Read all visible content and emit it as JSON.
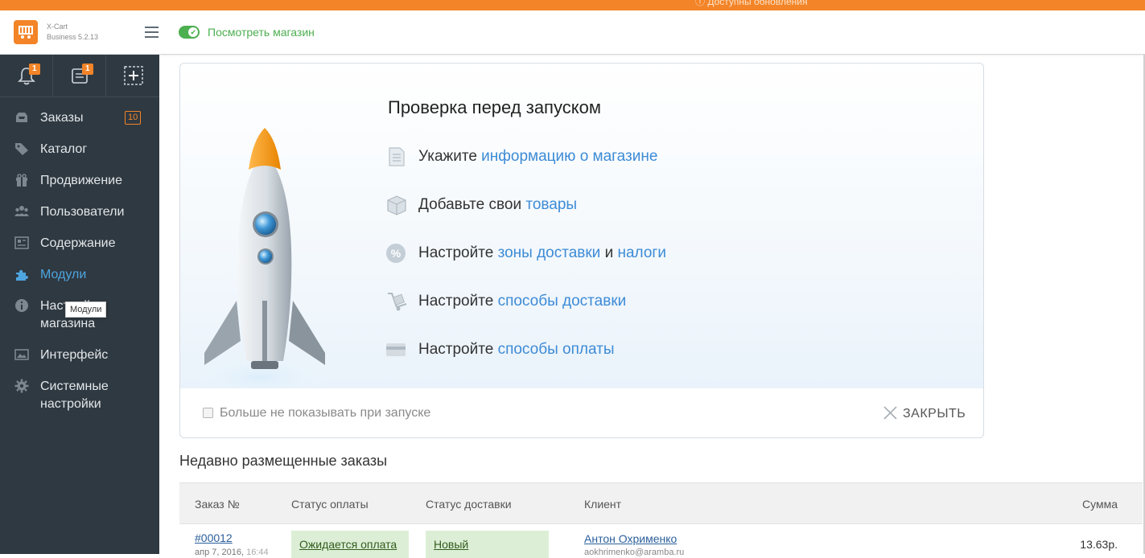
{
  "top_strip": {
    "updates_text": "Доступны обновления"
  },
  "header": {
    "brand_line1": "X-Cart",
    "brand_line2": "Business 5.2.13",
    "view_store_label": "Посмотреть магазин"
  },
  "quick_actions": [
    {
      "icon": "bell-icon",
      "badge": "1"
    },
    {
      "icon": "inbox-icon",
      "badge": "1"
    },
    {
      "icon": "add-icon"
    }
  ],
  "sidebar": {
    "items": [
      {
        "label": "Заказы",
        "icon": "orders-icon",
        "badge": "10"
      },
      {
        "label": "Каталог",
        "icon": "tag-icon"
      },
      {
        "label": "Продвижение",
        "icon": "gift-icon"
      },
      {
        "label": "Пользователи",
        "icon": "users-icon"
      },
      {
        "label": "Содержание",
        "icon": "content-icon"
      },
      {
        "label": "Модули",
        "icon": "puzzle-icon",
        "active": true
      },
      {
        "label_line1": "Настройки",
        "label_line2": "магазина",
        "icon": "info-icon"
      },
      {
        "label": "Интерфейс",
        "icon": "image-icon"
      },
      {
        "label_line1": "Системные",
        "label_line2": "настройки",
        "icon": "gear-icon"
      }
    ],
    "tooltip": "Модули"
  },
  "launch_card": {
    "title": "Проверка перед запуском",
    "steps": [
      {
        "icon": "document-icon",
        "text": "Укажите ",
        "link": "информацию о магазине"
      },
      {
        "icon": "box-icon",
        "text": "Добавьте свои ",
        "link": "товары"
      },
      {
        "icon": "percent-icon",
        "text": "Настройте ",
        "link": "зоны доставки",
        "text2": " и ",
        "link2": "налоги"
      },
      {
        "icon": "dolly-icon",
        "text": "Настройте ",
        "link": "способы доставки"
      },
      {
        "icon": "credit-card-icon",
        "text": "Настройте ",
        "link": "способы оплаты"
      }
    ],
    "dont_show_label": "Больше не показывать при запуске",
    "close_label": "ЗАКРЫТЬ"
  },
  "recent_orders": {
    "title": "Недавно размещенные заказы",
    "columns": [
      "Заказ №",
      "Статус оплаты",
      "Статус доставки",
      "Клиент",
      "Сумма"
    ],
    "rows": [
      {
        "order_num": "#00012",
        "date": "апр 7, 2016,",
        "time": "16:44",
        "payment_status": "Ожидается оплата",
        "shipping_status": "Новый",
        "customer": "Антон Охрименко",
        "email": "aokhrimenko@aramba.ru",
        "total": "13.63р."
      }
    ]
  },
  "colors": {
    "accent": "#f38427",
    "sidebar_bg": "#2f3941",
    "link": "#3d8bd6",
    "store_green": "#4caf50"
  }
}
